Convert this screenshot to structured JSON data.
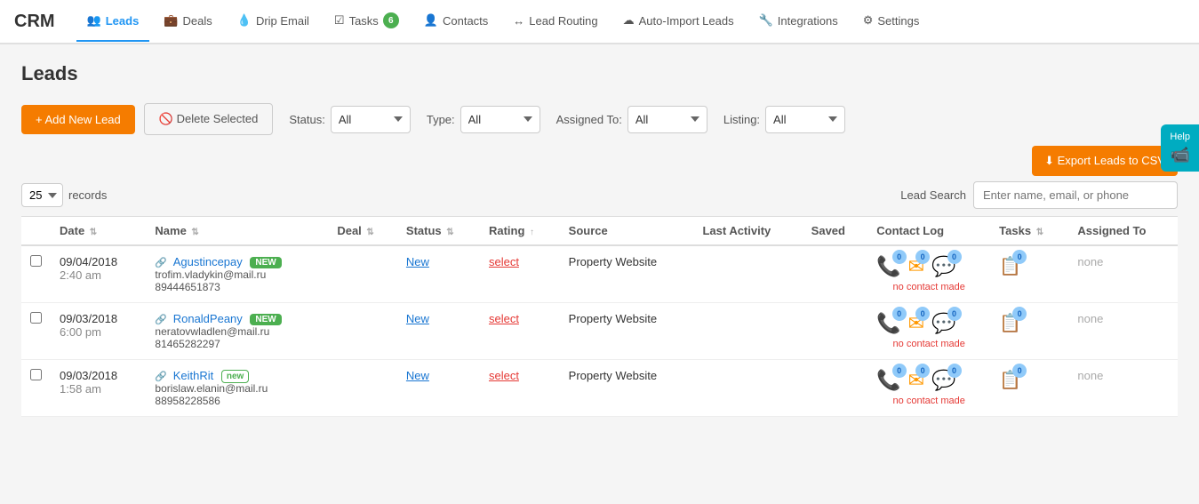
{
  "app": {
    "logo": "CRM"
  },
  "nav": {
    "items": [
      {
        "id": "leads",
        "label": "Leads",
        "icon": "👥",
        "active": true,
        "badge": null
      },
      {
        "id": "deals",
        "label": "Deals",
        "icon": "💼",
        "active": false,
        "badge": null
      },
      {
        "id": "drip-email",
        "label": "Drip Email",
        "icon": "💧",
        "active": false,
        "badge": null
      },
      {
        "id": "tasks",
        "label": "Tasks",
        "icon": "☑",
        "active": false,
        "badge": "6"
      },
      {
        "id": "contacts",
        "label": "Contacts",
        "icon": "👤",
        "active": false,
        "badge": null
      },
      {
        "id": "lead-routing",
        "label": "Lead Routing",
        "icon": "↔",
        "active": false,
        "badge": null
      },
      {
        "id": "auto-import",
        "label": "Auto-Import Leads",
        "icon": "☁",
        "active": false,
        "badge": null
      },
      {
        "id": "integrations",
        "label": "Integrations",
        "icon": "🔧",
        "active": false,
        "badge": null
      },
      {
        "id": "settings",
        "label": "Settings",
        "icon": "⚙",
        "active": false,
        "badge": null
      }
    ]
  },
  "page": {
    "title": "Leads"
  },
  "toolbar": {
    "add_label": "+ Add New Lead",
    "delete_label": "🚫 Delete Selected",
    "status_label": "Status:",
    "status_default": "All",
    "type_label": "Type:",
    "type_default": "All",
    "assigned_label": "Assigned To:",
    "assigned_default": "All",
    "listing_label": "Listing:",
    "listing_default": "All",
    "export_label": "⬇ Export Leads to CSV"
  },
  "records": {
    "per_page": "25",
    "label": "records",
    "search_label": "Lead Search",
    "search_placeholder": "Enter name, email, or phone"
  },
  "table": {
    "columns": [
      "",
      "Date",
      "Name",
      "Deal",
      "Status",
      "Rating",
      "Source",
      "Last Activity",
      "Saved",
      "Contact Log",
      "Tasks",
      "Assigned To"
    ],
    "rows": [
      {
        "id": 1,
        "date": "09/04/2018",
        "time": "2:40 am",
        "name": "Agustincepay",
        "name_badge": "NEW",
        "name_badge_style": "filled",
        "email": "trofim.vladykin@mail.ru",
        "phone": "89444651873",
        "deal": "",
        "status": "New",
        "rating": "select",
        "source": "Property Website",
        "last_activity": "",
        "saved": "",
        "contact_phone_count": "0",
        "contact_email_count": "0",
        "contact_chat_count": "0",
        "no_contact_text": "no contact made",
        "tasks_count": "0",
        "assigned": "none"
      },
      {
        "id": 2,
        "date": "09/03/2018",
        "time": "6:00 pm",
        "name": "RonaldPeany",
        "name_badge": "NEW",
        "name_badge_style": "filled",
        "email": "neratovwladlen@mail.ru",
        "phone": "81465282297",
        "deal": "",
        "status": "New",
        "rating": "select",
        "source": "Property Website",
        "last_activity": "",
        "saved": "",
        "contact_phone_count": "0",
        "contact_email_count": "0",
        "contact_chat_count": "0",
        "no_contact_text": "no contact made",
        "tasks_count": "0",
        "assigned": "none"
      },
      {
        "id": 3,
        "date": "09/03/2018",
        "time": "1:58 am",
        "name": "KeithRit",
        "name_badge": "new",
        "name_badge_style": "outline",
        "email": "borislaw.elanin@mail.ru",
        "phone": "88958228586",
        "deal": "",
        "status": "New",
        "rating": "select",
        "source": "Property Website",
        "last_activity": "",
        "saved": "",
        "contact_phone_count": "0",
        "contact_email_count": "0",
        "contact_chat_count": "0",
        "no_contact_text": "no contact made",
        "tasks_count": "0",
        "assigned": "none"
      }
    ]
  },
  "help": {
    "label": "Help"
  }
}
